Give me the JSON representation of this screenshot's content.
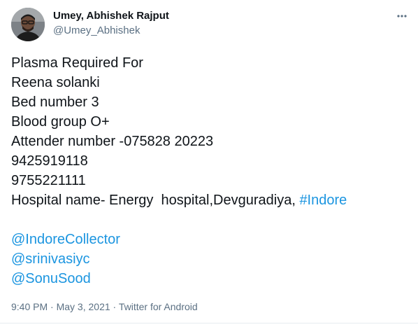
{
  "author": {
    "display_name": "Umey, Abhishek Rajput",
    "handle": "@Umey_Abhishek"
  },
  "tweet": {
    "lines": [
      "Plasma Required For",
      "Reena solanki",
      "Bed number 3",
      "Blood group O+",
      "Attender number -075828 20223",
      "9425919118",
      "9755221111"
    ],
    "hospital_prefix": "Hospital name- Energy  hospital,Devguradiya, ",
    "hashtag": "#Indore",
    "mentions": [
      "@IndoreCollector",
      "@srinivasiyc",
      "@SonuSood"
    ]
  },
  "meta": {
    "time": "9:40 PM",
    "separator": " · ",
    "date": "May 3, 2021",
    "source": "Twitter for Android"
  },
  "colors": {
    "link": "#1b95e0",
    "secondary_text": "#5b7083",
    "primary_text": "#0f1419"
  },
  "icons": {
    "more": "more-dots-icon",
    "avatar": "profile-photo"
  }
}
